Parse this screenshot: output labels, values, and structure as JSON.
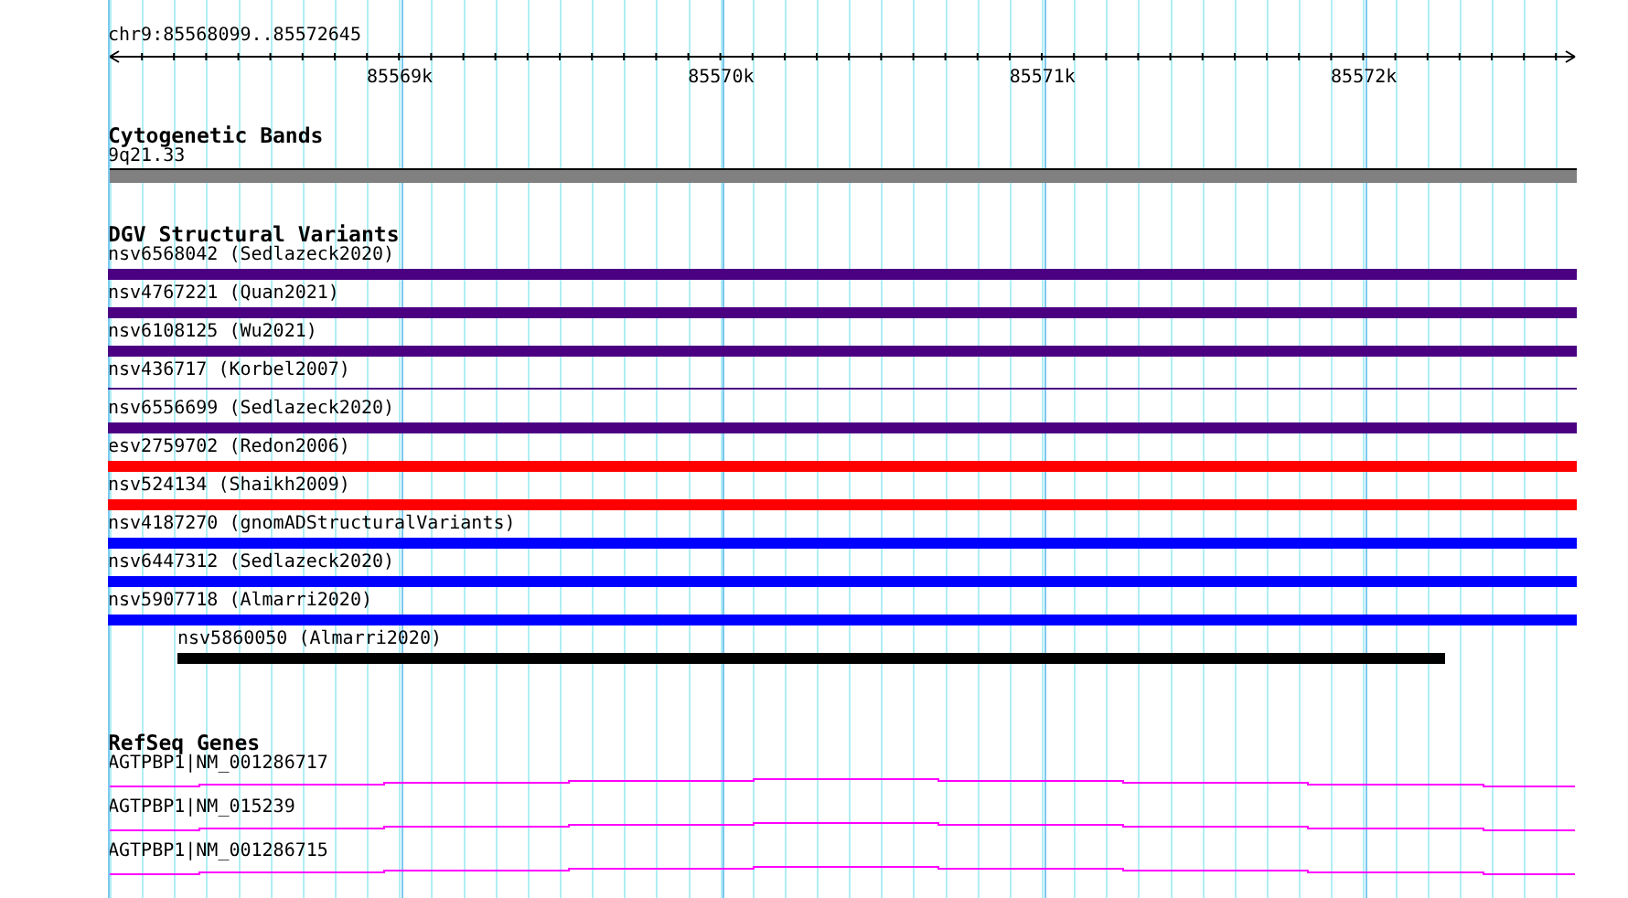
{
  "ruler": {
    "locus": "chr9:85568099..85572645",
    "ticks": [
      "85569k",
      "85570k",
      "85571k",
      "85572k"
    ]
  },
  "tracks": [
    {
      "kind": "cytoband",
      "title": "Cytogenetic Bands",
      "features": [
        {
          "label": "9q21.33"
        }
      ]
    },
    {
      "kind": "variants",
      "title": "DGV Structural Variants",
      "features": [
        {
          "label": "nsv6568042 (Sedlazeck2020)",
          "color": "#4b0082",
          "kind": "full"
        },
        {
          "label": "nsv4767221 (Quan2021)",
          "color": "#4b0082",
          "kind": "full"
        },
        {
          "label": "nsv6108125 (Wu2021)",
          "color": "#4b0082",
          "kind": "full"
        },
        {
          "label": "nsv436717 (Korbel2007)",
          "color": "#4b0082",
          "kind": "thin"
        },
        {
          "label": "nsv6556699 (Sedlazeck2020)",
          "color": "#4b0082",
          "kind": "full"
        },
        {
          "label": "esv2759702 (Redon2006)",
          "color": "#ff0000",
          "kind": "full"
        },
        {
          "label": "nsv524134 (Shaikh2009)",
          "color": "#ff0000",
          "kind": "full"
        },
        {
          "label": "nsv4187270 (gnomADStructuralVariants)",
          "color": "#0000ff",
          "kind": "full"
        },
        {
          "label": "nsv6447312 (Sedlazeck2020)",
          "color": "#0000ff",
          "kind": "full"
        },
        {
          "label": "nsv5907718 (Almarri2020)",
          "color": "#0000ff",
          "kind": "full"
        },
        {
          "label": "nsv5860050 (Almarri2020)",
          "color": "#000000",
          "kind": "partial"
        }
      ]
    },
    {
      "kind": "genes",
      "title": "RefSeq Genes",
      "features": [
        {
          "label": "AGTPBP1|NM_001286717"
        },
        {
          "label": "AGTPBP1|NM_015239"
        },
        {
          "label": "AGTPBP1|NM_001286715"
        }
      ]
    }
  ]
}
